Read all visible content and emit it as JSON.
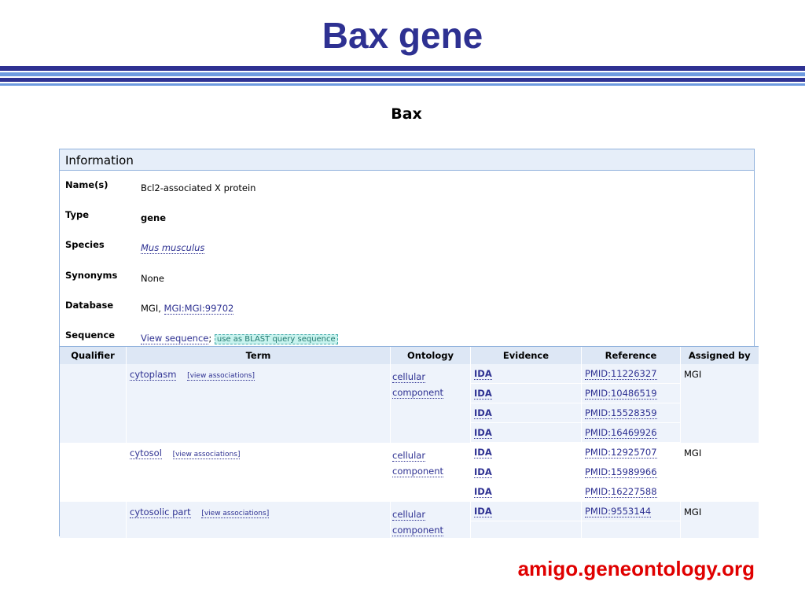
{
  "slide": {
    "title": "Bax gene",
    "footer": "amigo.geneontology.org",
    "colors": {
      "title": "#2e3192",
      "footer": "#e00000",
      "stripe_dark": "#2e3192",
      "stripe_light": "#6e9be0"
    }
  },
  "gene": {
    "heading": "Bax",
    "info_title": "Information",
    "fields": {
      "names_label": "Name(s)",
      "names_value": "Bcl2-associated X protein",
      "type_label": "Type",
      "type_value": "gene",
      "species_label": "Species",
      "species_value": "Mus musculus",
      "synonyms_label": "Synonyms",
      "synonyms_value": "None",
      "database_label": "Database",
      "database_prefix": "MGI,",
      "database_link": "MGI:MGI:99702",
      "sequence_label": "Sequence",
      "sequence_link": "View sequence",
      "sequence_sep": ";",
      "blast_link": "use as BLAST query sequence"
    }
  },
  "table": {
    "headers": [
      "Qualifier",
      "Term",
      "Ontology",
      "Evidence",
      "Reference",
      "Assigned by"
    ],
    "view_assoc": "[view associations]",
    "rows": [
      {
        "term": "cytoplasm",
        "ontology_1": "cellular",
        "ontology_2": "component",
        "assigned": "MGI",
        "evidence": [
          "IDA",
          "IDA",
          "IDA",
          "IDA"
        ],
        "references": [
          "PMID:11226327",
          "PMID:10486519",
          "PMID:15528359",
          "PMID:16469926"
        ]
      },
      {
        "term": "cytosol",
        "ontology_1": "cellular",
        "ontology_2": "component",
        "assigned": "MGI",
        "evidence": [
          "IDA",
          "IDA",
          "IDA"
        ],
        "references": [
          "PMID:12925707",
          "PMID:15989966",
          "PMID:16227588"
        ]
      },
      {
        "term": "cytosolic part",
        "ontology_1": "cellular",
        "ontology_2": "component",
        "assigned": "MGI",
        "evidence": [
          "IDA"
        ],
        "references": [
          "PMID:9553144"
        ]
      }
    ]
  }
}
